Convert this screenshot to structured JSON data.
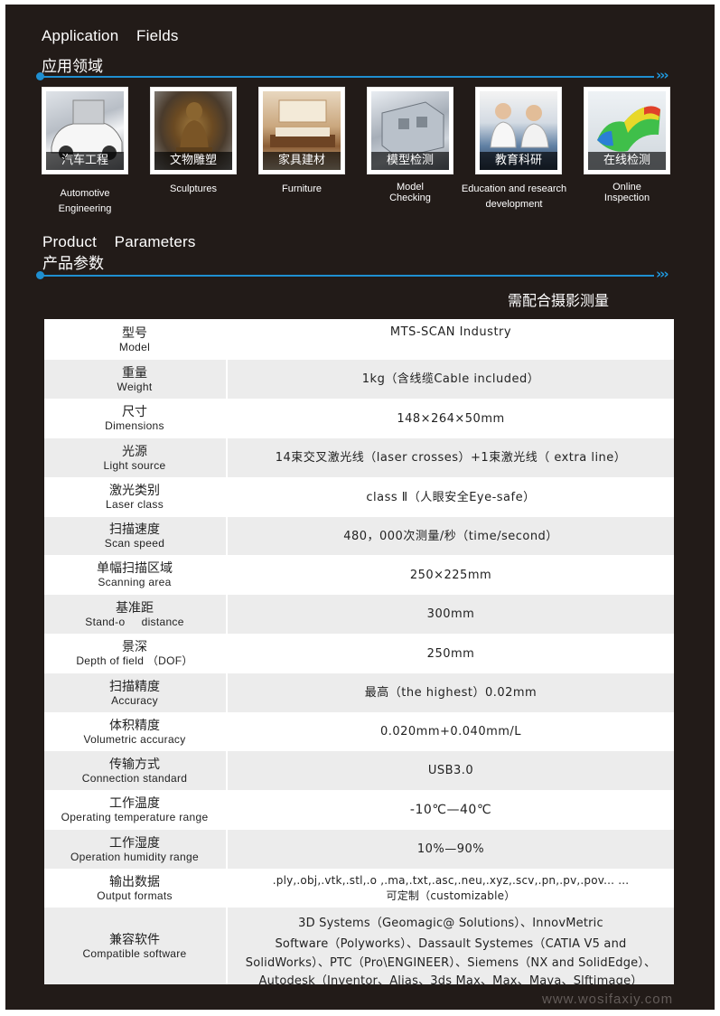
{
  "section_application": {
    "title_en": "Application    Fields",
    "title_cn": "应用领域",
    "arrows": "›››"
  },
  "applications": [
    {
      "cn": "汽车工程",
      "en_lines": [
        "Automotive",
        "Engineering"
      ]
    },
    {
      "cn": "文物雕塑",
      "en_lines": [
        "Sculptures"
      ]
    },
    {
      "cn": "家具建材",
      "en_lines": [
        "Furniture"
      ]
    },
    {
      "cn": "模型检测",
      "en_lines": [
        "Model",
        "Checking"
      ]
    },
    {
      "cn": "教育科研",
      "en_lines": [
        "Education  and  research",
        "development"
      ]
    },
    {
      "cn": "在线检测",
      "en_lines": [
        "Online",
        "Inspection"
      ]
    }
  ],
  "section_params": {
    "title_en": "Product    Parameters",
    "title_cn": "产品参数",
    "arrows": "›››",
    "note": "需配合摄影测量"
  },
  "params": [
    {
      "cn": "型号",
      "en": "Model",
      "value": [
        "MTS-SCAN  Industry"
      ]
    },
    {
      "cn": "重量",
      "en": "Weight",
      "value": [
        "1kg（含线缆Cable  included）"
      ]
    },
    {
      "cn": "尺寸",
      "en": "Dimensions",
      "value": [
        "148×264×50mm"
      ]
    },
    {
      "cn": "光源",
      "en": "Light  source",
      "value": [
        "14束交叉激光线（laser  crosses）+1束激光线（  extra  line）"
      ]
    },
    {
      "cn": "激光类别",
      "en": "Laser  class",
      "value": [
        "class Ⅱ（人眼安全Eye-safe）"
      ]
    },
    {
      "cn": "扫描速度",
      "en": "Scan  speed",
      "value": [
        "480，000次测量/秒（time/second）"
      ]
    },
    {
      "cn": "单幅扫描区域",
      "en": "Scanning  area",
      "value": [
        "250×225mm"
      ]
    },
    {
      "cn": "基准距",
      "en": "Stand-o     distance",
      "value": [
        "300mm"
      ]
    },
    {
      "cn": "景深",
      "en": "Depth  of  field （DOF）",
      "value": [
        "250mm"
      ]
    },
    {
      "cn": "扫描精度",
      "en": "Accuracy",
      "value": [
        "最高（the  highest）0.02mm"
      ]
    },
    {
      "cn": "体积精度",
      "en": "Volumetric  accuracy",
      "value": [
        "0.020mm+0.040mm/L"
      ]
    },
    {
      "cn": "传输方式",
      "en": "Connection  standard",
      "value": [
        "USB3.0"
      ]
    },
    {
      "cn": "工作温度",
      "en": "Operating  temperature  range",
      "value": [
        "-10℃—40℃"
      ]
    },
    {
      "cn": "工作湿度",
      "en": "Operation  humidity  range",
      "value": [
        "10%—90%"
      ]
    },
    {
      "cn": "输出数据",
      "en": "Output  formats",
      "value": [
        ".ply,.obj,.vtk,.stl,.o   ,.ma,.txt,.asc,.neu,.xyz,.scv,.pn,.pv,.pov...  ...",
        "可定制（customizable）"
      ]
    },
    {
      "cn": "兼容软件",
      "en": "Compatible  software",
      "value": [
        "3D  Systems（Geomagic@     Solutions）、InnovMetric",
        "Software（Polyworks）、Dassault  Systemes（CATIA  V5  and",
        "SolidWorks）、PTC（Pro\\ENGINEER）、Siemens（NX  and  SolidEdge）、",
        "Autodesk（Inventor、Alias、3ds  Max、Max、Maya、Slftimage）"
      ]
    }
  ],
  "watermark": "www.wosifaxiy.com"
}
